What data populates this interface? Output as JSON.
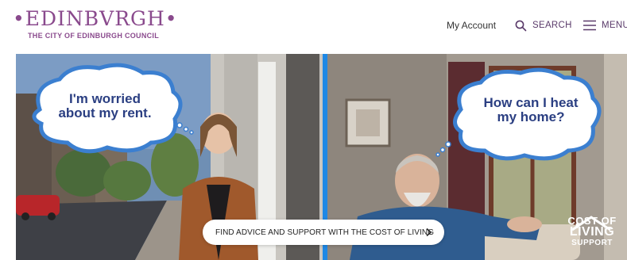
{
  "header": {
    "logo_main": "•EDINBVRGH•",
    "logo_sub": "THE CITY OF EDINBURGH COUNCIL",
    "account_label": "My Account",
    "search_label": "SEARCH",
    "menu_label": "MENU"
  },
  "hero": {
    "bubble_left": "I'm worried about my rent.",
    "bubble_right": "How can I heat my home?",
    "cta_label": "FIND ADVICE AND SUPPORT WITH THE COST OF LIVING",
    "badge": {
      "line1": "COST OF",
      "line2": "LIVING",
      "line3": "SUPPORT"
    }
  },
  "colors": {
    "brand_purple": "#8a4a8d",
    "bubble_text": "#2b3f82",
    "divider_blue": "#1e88e5"
  },
  "icons": {
    "search": "search-icon",
    "menu": "hamburger-icon",
    "cta": "chevron-right-icon",
    "badge": "house-icon"
  }
}
